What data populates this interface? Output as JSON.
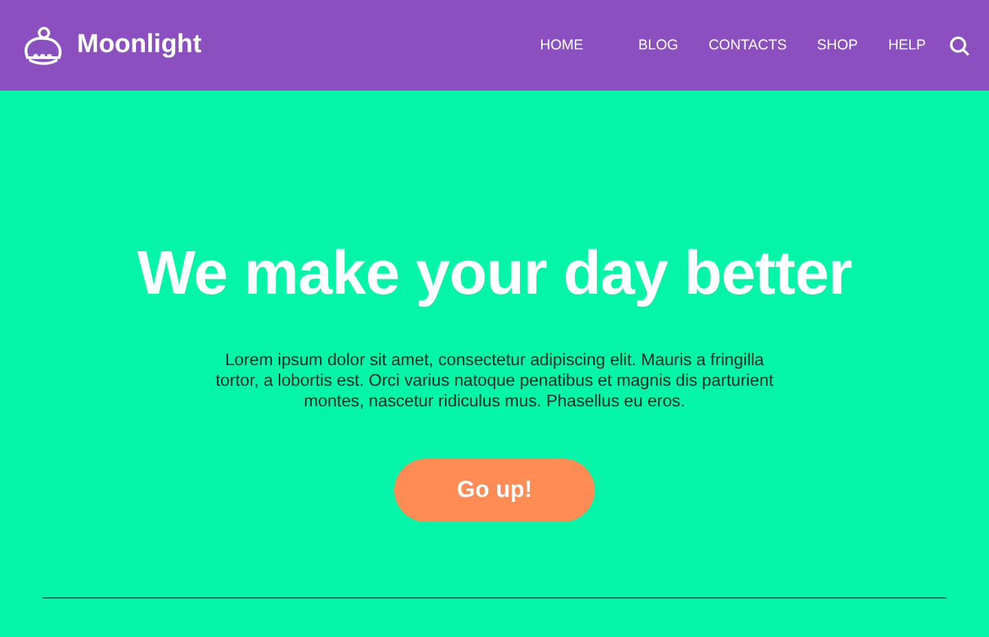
{
  "brand": {
    "name": "Moonlight"
  },
  "nav": [
    "HOME",
    "BLOG",
    "CONTACTS",
    "SHOP",
    "HELP"
  ],
  "hero": {
    "title": "We make your day better",
    "text": "Lorem ipsum dolor sit amet, consectetur adipiscing elit. Mauris a fringilla tortor, a lobortis est. Orci varius natoque penatibus et magnis dis parturient montes, nascetur ridiculus mus. Phasellus eu eros.",
    "button": "Go up!"
  }
}
